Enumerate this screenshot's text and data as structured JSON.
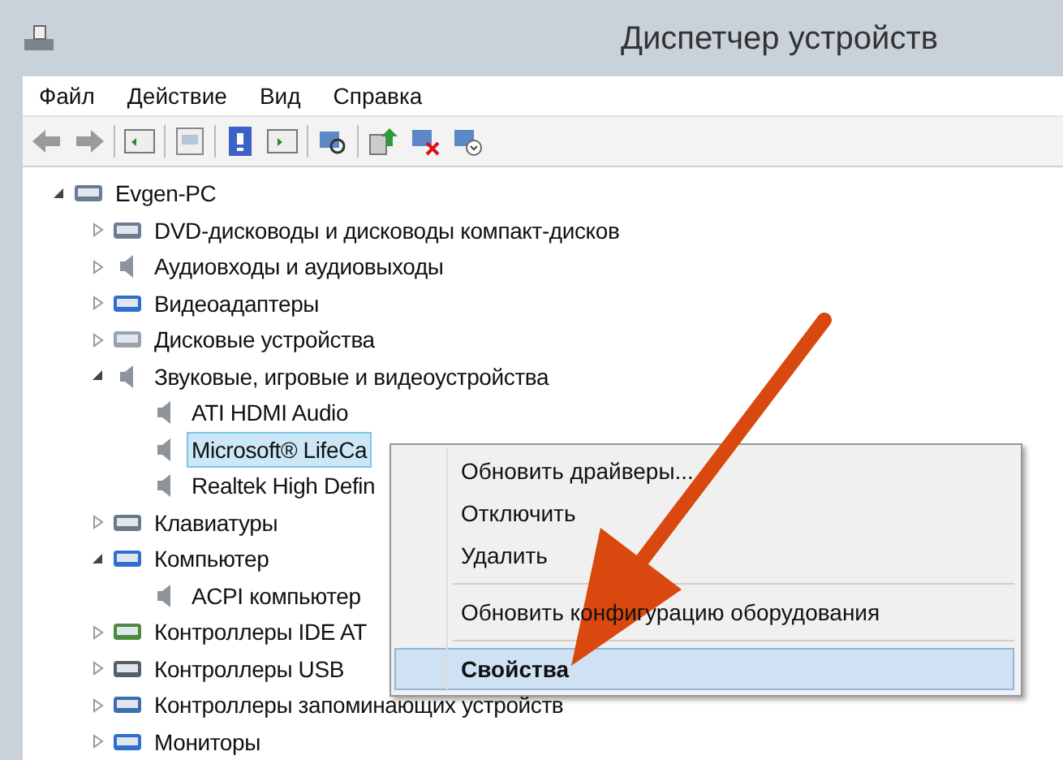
{
  "window": {
    "title": "Диспетчер устройств"
  },
  "menu_bar": [
    "Файл",
    "Действие",
    "Вид",
    "Справка"
  ],
  "tree": {
    "label": "Evgen-PC",
    "kind": "group",
    "expanded": true,
    "selected": false,
    "children": [
      {
        "label": "DVD-дисководы и дисководы компакт-дисков",
        "kind": "group",
        "expanded": false,
        "selected": false
      },
      {
        "label": "Аудиовходы и аудиовыходы",
        "kind": "group",
        "expanded": false,
        "selected": false
      },
      {
        "label": "Видеоадаптеры",
        "kind": "group",
        "expanded": false,
        "selected": false
      },
      {
        "label": "Дисковые устройства",
        "kind": "group",
        "expanded": false,
        "selected": false
      },
      {
        "label": "Звуковые, игровые и видеоустройства",
        "kind": "group",
        "expanded": true,
        "selected": false,
        "children": [
          {
            "label": "ATI HDMI Audio",
            "kind": "device",
            "selected": false
          },
          {
            "label": "Microsoft® LifeCa",
            "kind": "device",
            "selected": true
          },
          {
            "label": "Realtek High Defin",
            "kind": "device",
            "selected": false
          }
        ]
      },
      {
        "label": "Клавиатуры",
        "kind": "group",
        "expanded": false,
        "selected": false
      },
      {
        "label": "Компьютер",
        "kind": "group",
        "expanded": true,
        "selected": false,
        "children": [
          {
            "label": "ACPI компьютер",
            "kind": "device",
            "selected": false
          }
        ]
      },
      {
        "label": "Контроллеры IDE AT",
        "kind": "group",
        "expanded": false,
        "selected": false
      },
      {
        "label": "Контроллеры USB",
        "kind": "group",
        "expanded": false,
        "selected": false
      },
      {
        "label": "Контроллеры запоминающих устройств",
        "kind": "group",
        "expanded": false,
        "selected": false
      },
      {
        "label": "Мониторы",
        "kind": "group",
        "expanded": false,
        "selected": false
      }
    ]
  },
  "context_menu": [
    {
      "kind": "item",
      "label": "Обновить драйверы...",
      "selected": false,
      "default": false
    },
    {
      "kind": "item",
      "label": "Отключить",
      "selected": false,
      "default": false
    },
    {
      "kind": "item",
      "label": "Удалить",
      "selected": false,
      "default": false
    },
    {
      "kind": "separator"
    },
    {
      "kind": "item",
      "label": "Обновить конфигурацию оборудования",
      "selected": false,
      "default": false
    },
    {
      "kind": "separator"
    },
    {
      "kind": "item",
      "label": "Свойства",
      "selected": true,
      "default": true
    }
  ]
}
